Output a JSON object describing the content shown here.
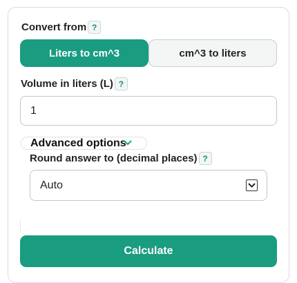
{
  "convert_from": {
    "label": "Convert from",
    "help": "?"
  },
  "mode_tabs": [
    {
      "label": "Liters to cm^3",
      "selected": true
    },
    {
      "label": "cm^3 to liters",
      "selected": false
    }
  ],
  "volume": {
    "label": "Volume in liters (L)",
    "help": "?",
    "value": "1"
  },
  "advanced": {
    "label": "Advanced options"
  },
  "rounding": {
    "label": "Round answer to (decimal places)",
    "help": "?",
    "selected": "Auto"
  },
  "calculate": {
    "label": "Calculate"
  },
  "colors": {
    "accent": "#1a9c81",
    "help_text": "#1a8d7a",
    "border": "#c6c6c6"
  }
}
